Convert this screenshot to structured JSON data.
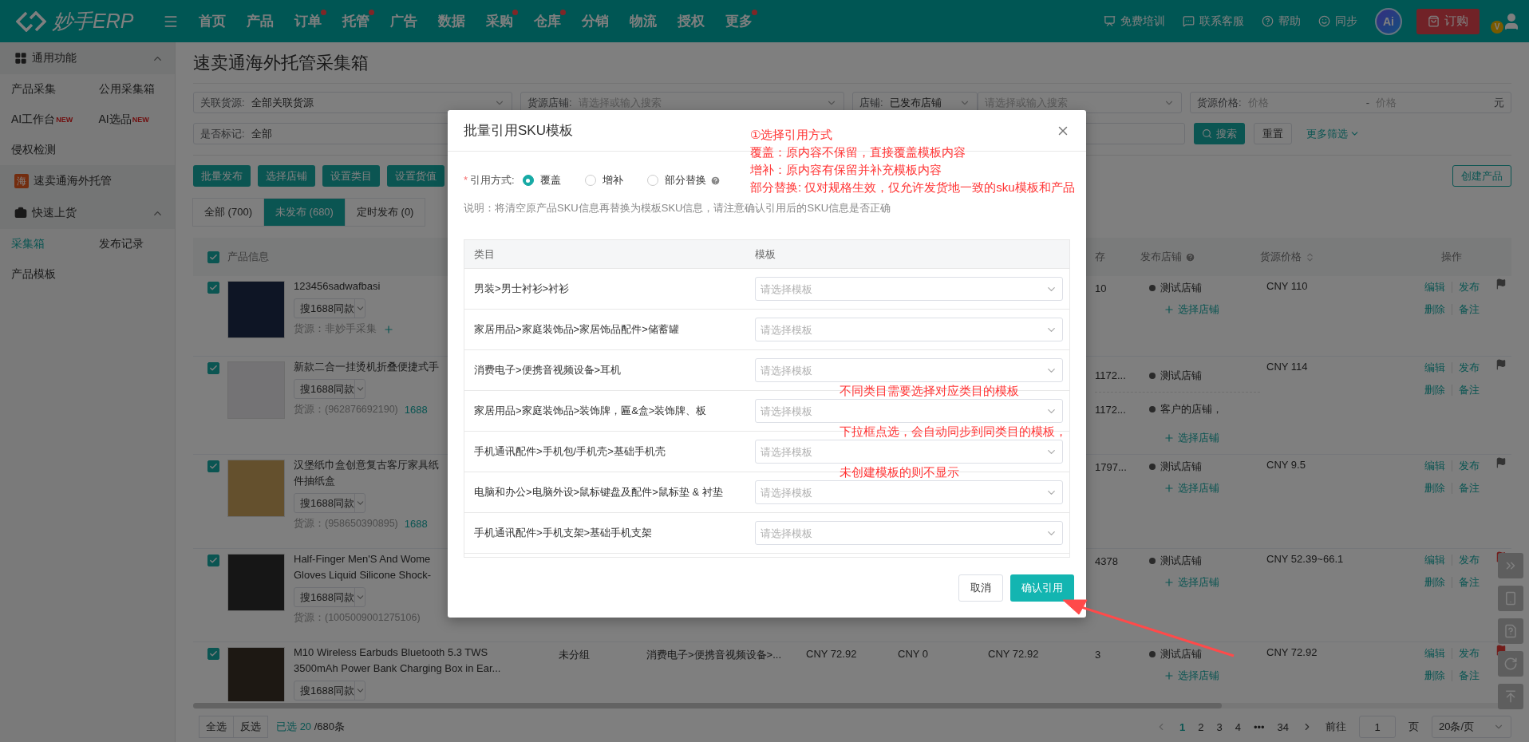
{
  "top_nav": {
    "logo": "妙手ERP",
    "items": [
      {
        "label": "首页",
        "dot": false
      },
      {
        "label": "产品",
        "dot": false
      },
      {
        "label": "订单",
        "dot": true
      },
      {
        "label": "托管",
        "dot": true
      },
      {
        "label": "广告",
        "dot": false
      },
      {
        "label": "数据",
        "dot": false
      },
      {
        "label": "采购",
        "dot": true
      },
      {
        "label": "仓库",
        "dot": true
      },
      {
        "label": "分销",
        "dot": false
      },
      {
        "label": "物流",
        "dot": false
      },
      {
        "label": "授权",
        "dot": false
      },
      {
        "label": "更多",
        "dot": true
      }
    ],
    "right_links": [
      {
        "kind": "training",
        "label": "免费培训"
      },
      {
        "kind": "service",
        "label": "联系客服"
      },
      {
        "kind": "help",
        "label": "帮助"
      },
      {
        "kind": "sync",
        "label": "同步"
      }
    ],
    "ai_badge": "Ai",
    "order_button": "订购",
    "avatar_badge": "V"
  },
  "sidebar": {
    "sections": [
      {
        "title": "通用功能",
        "kind": "grid",
        "expanded": true,
        "items": [
          {
            "kind": "link",
            "label": "产品采集",
            "selected": false
          },
          {
            "kind": "link",
            "label": "公用采集箱",
            "selected": false
          },
          {
            "kind": "link",
            "label": "AI工作台",
            "badge": "NEW",
            "selected": false
          },
          {
            "kind": "link",
            "label": "AI选品",
            "badge": "NEW",
            "selected": false
          },
          {
            "kind": "link",
            "label": "侵权检测",
            "selected": false
          },
          {
            "kind": "featured",
            "label": "速卖通海外托管",
            "icon_text": "海",
            "selected": false
          }
        ]
      },
      {
        "title": "快速上货",
        "kind": "bag",
        "expanded": true,
        "items": [
          {
            "kind": "link",
            "label": "采集箱",
            "selected": true
          },
          {
            "kind": "link",
            "label": "发布记录",
            "selected": false
          },
          {
            "kind": "link",
            "label": "产品模板",
            "selected": false
          }
        ]
      }
    ]
  },
  "page_title": "速卖通海外托管采集箱",
  "filters": {
    "row_1": [
      {
        "kind": "select",
        "label": "关联货源:",
        "value": "全部关联货源"
      },
      {
        "kind": "select",
        "label": "货源店铺:",
        "placeholder": "请选择或输入搜索"
      },
      {
        "kind": "select",
        "label": "店铺:",
        "value": "已发布店铺"
      },
      {
        "kind": "select",
        "placeholder": "请选择或输入搜索"
      },
      {
        "kind": "range",
        "label": "货源价格:",
        "placeholder_from": "价格",
        "separator": "-",
        "placeholder_to": "价格",
        "unit": "元"
      }
    ],
    "row_2": [
      {
        "kind": "select",
        "label": "是否标记:",
        "value": "全部"
      },
      {
        "kind": "input"
      }
    ],
    "search_button": "搜索",
    "reset_button": "重置",
    "more_filters": "更多筛选"
  },
  "actions": [
    "批量发布",
    "选择店铺",
    "设置类目",
    "设置货值"
  ],
  "create_button": "创建产品",
  "tabs": [
    {
      "label": "全部 (700)",
      "selected": false
    },
    {
      "label": "未发布 (680)",
      "selected": true
    },
    {
      "label": "定时发布 (0)",
      "selected": false
    }
  ],
  "table": {
    "all_checked": true,
    "columns": {
      "product": "产品信息",
      "stock": "存",
      "stores": "发布店铺",
      "source_price": "货源价格",
      "actions": "操作"
    },
    "rows": [
      {
        "checked": true,
        "flagged": false,
        "title_lines": [
          "123456sadwafbasi"
        ],
        "search_button": "搜1688同款",
        "source": "货源：非妙手采集",
        "source_add": true,
        "stores": [
          {
            "name": "测试店铺",
            "stock": "10"
          }
        ],
        "add_store": "选择店铺",
        "source_price": "CNY 110",
        "actions": [
          "编辑",
          "发布",
          "删除",
          "备注"
        ]
      },
      {
        "checked": true,
        "flagged": false,
        "title_lines": [
          "新款二合一挂烫机折叠便捷式手"
        ],
        "search_button": "搜1688同款",
        "source": "货源：(962876692190)",
        "source_tag": "1688",
        "stores": [
          {
            "name": "测试店铺",
            "stock": "1172..."
          },
          {
            "name": "客户的店铺，",
            "stock": "1172..."
          }
        ],
        "add_store": "选择店铺",
        "source_price": "CNY 114",
        "actions": [
          "编辑",
          "发布",
          "删除",
          "备注"
        ]
      },
      {
        "checked": true,
        "flagged": false,
        "title_lines": [
          "汉堡纸巾盒创意复古客厅家具纸",
          "件抽纸盒"
        ],
        "search_button": "搜1688同款",
        "source": "货源：(958650390895)",
        "source_tag": "1688",
        "stores": [
          {
            "name": "测试店铺",
            "stock": "1797..."
          }
        ],
        "add_store": "选择店铺",
        "source_price": "CNY 9.5",
        "actions": [
          "编辑",
          "发布",
          "删除",
          "备注"
        ]
      },
      {
        "checked": true,
        "flagged": true,
        "title_lines": [
          "Half-Finger Men'S And Wome",
          "Gloves Liquid Silicone Shock-"
        ],
        "search_button": "搜1688同款",
        "source": "货源：(1005009001275106)",
        "stores": [
          {
            "name": "测试店铺",
            "stock": "4378"
          }
        ],
        "add_store": "选择店铺",
        "source_price": "CNY 52.39~66.1",
        "actions": [
          "编辑",
          "发布",
          "删除",
          "备注"
        ]
      },
      {
        "checked": true,
        "flagged": true,
        "title_lines": [
          "M10 Wireless Earbuds Bluetooth 5.3 TWS",
          "3500mAh Power Bank Charging Box in Ear..."
        ],
        "search_button": "搜1688同款",
        "group": "未分组",
        "category": "消费电子>便携音视频设备>...",
        "price_1": "CNY 72.92",
        "price_2": "CNY 0",
        "price_3": "CNY 72.92",
        "stores": [
          {
            "name": "测试店铺",
            "stock": "3"
          }
        ],
        "add_store": "选择店铺",
        "source_price": "CNY 72.92",
        "actions": [
          "编辑",
          "发布",
          "删除",
          "备注"
        ]
      }
    ]
  },
  "footer": {
    "select_all": "全选",
    "invert": "反选",
    "selected_label": "已选",
    "selected_count": "20",
    "total": "/680条",
    "pages": [
      {
        "label": "1",
        "selected": true
      },
      {
        "label": "2",
        "selected": false
      },
      {
        "label": "3",
        "selected": false
      },
      {
        "label": "4",
        "selected": false
      }
    ],
    "ellipsis": "•••",
    "last_page": "34",
    "goto_label": "前往",
    "goto_value": "1",
    "page_unit": "页",
    "page_size": "20条/页"
  },
  "modal": {
    "title": "批量引用SKU模板",
    "required_mark": "*",
    "mode_label": "引用方式:",
    "options": [
      {
        "label": "覆盖",
        "selected": true
      },
      {
        "label": "增补",
        "selected": false
      },
      {
        "label": "部分替换",
        "selected": false,
        "help": true
      }
    ],
    "note": "说明：将清空原产品SKU信息再替换为模板SKU信息，请注意确认引用后的SKU信息是否正确",
    "columns": [
      "类目",
      "模板"
    ],
    "rows": [
      {
        "category": "男装>男士衬衫>衬衫",
        "placeholder": "请选择模板"
      },
      {
        "category": "家居用品>家庭装饰品>家居饰品配件>储蓄罐",
        "placeholder": "请选择模板"
      },
      {
        "category": "消费电子>便携音视频设备>耳机",
        "placeholder": "请选择模板"
      },
      {
        "category": "家居用品>家庭装饰品>装饰牌，匾&盒>装饰牌、板",
        "placeholder": "请选择模板"
      },
      {
        "category": "手机通讯配件>手机包/手机壳>基础手机壳",
        "placeholder": "请选择模板"
      },
      {
        "category": "电脑和办公>电脑外设>鼠标键盘及配件>鼠标垫 & 衬垫",
        "placeholder": "请选择模板"
      },
      {
        "category": "手机通讯配件>手机支架>基础手机支架",
        "placeholder": "请选择模板"
      }
    ],
    "cancel_button": "取消",
    "confirm_button": "确认引用"
  },
  "annotations": [
    {
      "lines": [
        "①选择引用方式",
        "覆盖：原内容不保留，直接覆盖模板内容",
        "增补：原内容有保留并补充模板内容",
        "部分替换: 仅对规格生效，仅允许发货地一致的sku模板和产品"
      ]
    },
    {
      "lines": [
        "不同类目需要选择对应类目的模板",
        "下拉框点选，会自动同步到同类目的模板，",
        "未创建模板的则不显示"
      ]
    }
  ]
}
